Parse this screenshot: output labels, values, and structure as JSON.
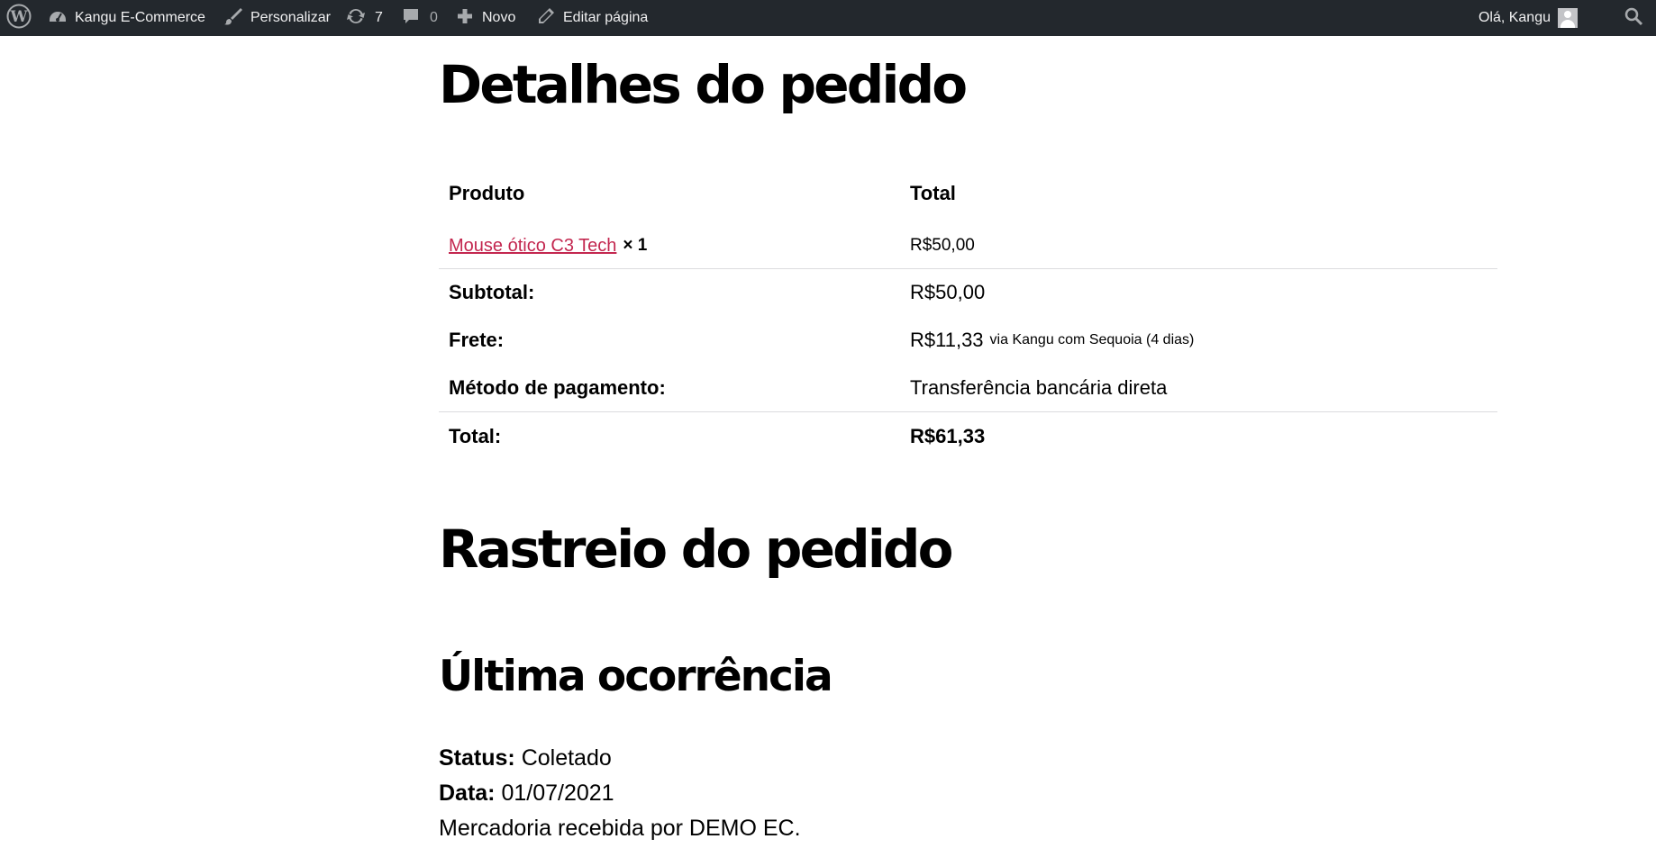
{
  "admin_bar": {
    "site_name": "Kangu E-Commerce",
    "customize": "Personalizar",
    "updates_count": "7",
    "comments_count": "0",
    "new": "Novo",
    "edit_page": "Editar página",
    "greeting": "Olá, Kangu",
    "icons": [
      "wordpress-icon",
      "dashboard-icon",
      "brush-icon",
      "updates-icon",
      "comment-icon",
      "plus-icon",
      "pencil-icon",
      "avatar",
      "search-icon"
    ]
  },
  "order": {
    "title": "Detalhes do pedido",
    "col_product": "Produto",
    "col_total": "Total",
    "items": [
      {
        "name": "Mouse ótico C3 Tech",
        "qty": "× 1",
        "total": "R$50,00"
      }
    ],
    "subtotal_label": "Subtotal:",
    "subtotal_value": "R$50,00",
    "shipping_label": "Frete:",
    "shipping_value": "R$11,33",
    "shipping_note": "via Kangu com Sequoia (4 dias)",
    "payment_label": "Método de pagamento:",
    "payment_value": "Transferência bancária direta",
    "total_label": "Total:",
    "total_value": "R$61,33"
  },
  "tracking": {
    "title": "Rastreio do pedido",
    "subtitle": "Última ocorrência",
    "status_label": "Status:",
    "status_value": "Coletado",
    "date_label": "Data:",
    "date_value": "01/07/2021",
    "description": "Mercadoria recebida por DEMO EC."
  },
  "colors": {
    "admin_bar_bg": "#23282d",
    "admin_bar_text": "#f0f0f1",
    "link": "#c3274f"
  }
}
